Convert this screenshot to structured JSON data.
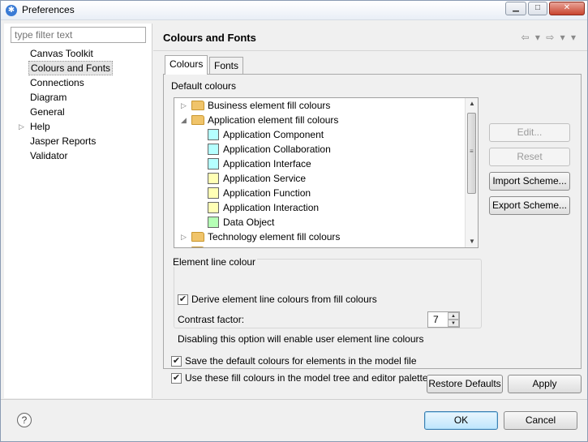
{
  "window": {
    "title": "Preferences",
    "minimize": "▁",
    "maximize": "□",
    "close": "✕"
  },
  "left": {
    "filter_placeholder": "type filter text",
    "items": [
      {
        "label": "Canvas Toolkit",
        "expander": ""
      },
      {
        "label": "Colours and Fonts",
        "expander": ""
      },
      {
        "label": "Connections",
        "expander": ""
      },
      {
        "label": "Diagram",
        "expander": ""
      },
      {
        "label": "General",
        "expander": ""
      },
      {
        "label": "Help",
        "expander": "▷"
      },
      {
        "label": "Jasper Reports",
        "expander": ""
      },
      {
        "label": "Validator",
        "expander": ""
      }
    ]
  },
  "page": {
    "title": "Colours and Fonts",
    "nav": "⇦ ▾ ⇨ ▾ ▾",
    "tabs": [
      {
        "label": "Colours"
      },
      {
        "label": "Fonts"
      }
    ],
    "default_colours_label": "Default colours",
    "tree": [
      {
        "kind": "category",
        "expander": "▷",
        "label": "Business element fill colours"
      },
      {
        "kind": "category",
        "expander": "◢",
        "label": "Application element fill colours"
      },
      {
        "kind": "item",
        "label": "Application Component",
        "color": "#b5ffff"
      },
      {
        "kind": "item",
        "label": "Application Collaboration",
        "color": "#b5ffff"
      },
      {
        "kind": "item",
        "label": "Application Interface",
        "color": "#b5ffff"
      },
      {
        "kind": "item",
        "label": "Application Service",
        "color": "#ffffb5"
      },
      {
        "kind": "item",
        "label": "Application Function",
        "color": "#ffffb5"
      },
      {
        "kind": "item",
        "label": "Application Interaction",
        "color": "#ffffb5"
      },
      {
        "kind": "item",
        "label": "Data Object",
        "color": "#b5ffb5"
      },
      {
        "kind": "category",
        "expander": "▷",
        "label": "Technology element fill colours"
      },
      {
        "kind": "category",
        "expander": "▷",
        "label": "Motivation element fill colours"
      }
    ],
    "scroll": {
      "up": "▲",
      "down": "▼",
      "grip": "≡"
    },
    "side_buttons": {
      "edit": "Edit...",
      "reset": "Reset",
      "import": "Import Scheme...",
      "export": "Export Scheme..."
    },
    "line_colour": {
      "legend": "Element line colour",
      "derive_label": "Derive element line colours from fill colours",
      "derive_checked": "✔",
      "contrast_label": "Contrast factor:",
      "contrast_value": "7",
      "spin_up": "▲",
      "spin_down": "▼",
      "note": "Disabling this option will enable user element line colours"
    },
    "save_label": "Save the default colours for elements in the model file",
    "save_checked": "✔",
    "use_label": "Use these fill colours in the model tree and editor palette",
    "use_checked": "✔",
    "restore_defaults": "Restore Defaults",
    "apply": "Apply"
  },
  "footer": {
    "help": "?",
    "ok": "OK",
    "cancel": "Cancel"
  }
}
